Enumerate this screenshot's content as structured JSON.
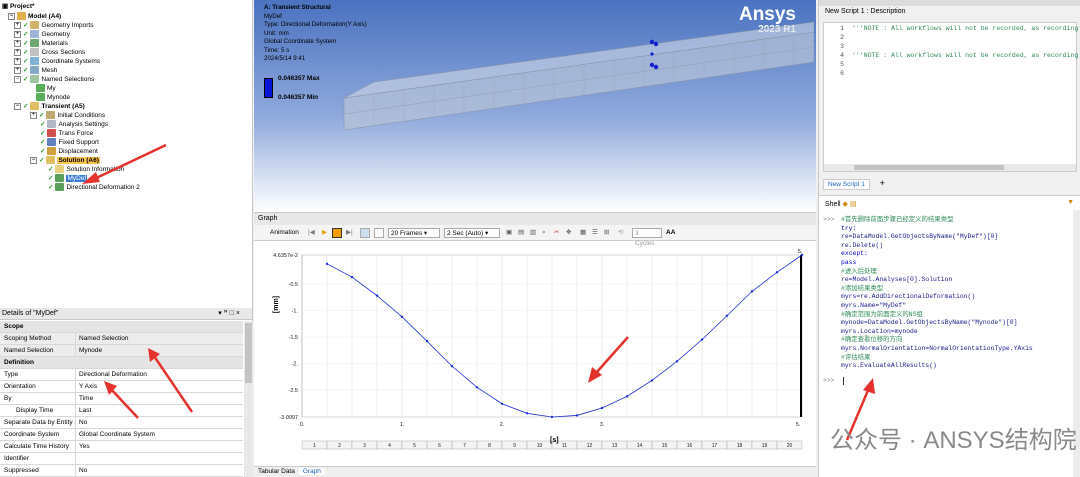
{
  "tree": {
    "project": "Project*",
    "model": "Model (A4)",
    "items": [
      "Geometry Imports",
      "Geometry",
      "Materials",
      "Cross Sections",
      "Coordinate Systems",
      "Mesh",
      "Named Selections",
      "My",
      "Mynode",
      "Transient (A5)",
      "Initial Conditions",
      "Analysis Settings",
      "Trans Force",
      "Fixed Support",
      "Displacement",
      "Solution (A6)",
      "Solution Information",
      "MyDef",
      "Directional Deformation 2"
    ]
  },
  "details": {
    "title": "Details of \"MyDef\"",
    "pin_glyph": "▾ ꟸ □ ×",
    "rows": [
      {
        "k": "Scope",
        "v": "",
        "section": true
      },
      {
        "k": "Scoping Method",
        "v": "Named Selection"
      },
      {
        "k": "Named Selection",
        "v": "Mynode"
      },
      {
        "k": "Definition",
        "v": "",
        "section": true
      },
      {
        "k": "Type",
        "v": "Directional Deformation"
      },
      {
        "k": "Orientation",
        "v": "Y Axis"
      },
      {
        "k": "By",
        "v": "Time"
      },
      {
        "k": "Display Time",
        "v": "Last"
      },
      {
        "k": "Separate Data by Entity",
        "v": "No"
      },
      {
        "k": "Coordinate System",
        "v": "Global Coordinate System"
      },
      {
        "k": "Calculate Time History",
        "v": "Yes"
      },
      {
        "k": "Identifier",
        "v": ""
      },
      {
        "k": "Suppressed",
        "v": "No"
      }
    ]
  },
  "viewport": {
    "header": "A: Transient Structural",
    "lines": [
      "MyDef",
      "Type: Directional Deformation(Y Axis)",
      "Unit: mm",
      "Global Coordinate System",
      "Time: 5 s",
      "2024/5/14 9:41"
    ],
    "max_label": "0.046357 Max",
    "min_label": "0.046357 Min",
    "logo": "Ansys",
    "version": "2023 R1"
  },
  "graph": {
    "title": "Graph",
    "toolbar": {
      "animation": "Animation",
      "frames": "20 Frames",
      "duration": "2 Sec (Auto)",
      "cycles": "3 Cycles",
      "aa": "AA"
    },
    "tabs": [
      "Tabular Data",
      "Graph"
    ]
  },
  "chart_data": {
    "type": "line",
    "ylabel": "[mm]",
    "xlabel": "[s]",
    "y_ticks": [
      "4.6357e-2",
      "-0.5",
      "-1.",
      "-1.5",
      "-2.",
      "-2.5",
      "-3.0097"
    ],
    "x_ticks": [
      "0.",
      "1.",
      "2.",
      "3.",
      "5."
    ],
    "frame_labels": [
      "1",
      "2",
      "3",
      "4",
      "5",
      "6",
      "7",
      "8",
      "9",
      "10",
      "11",
      "12",
      "13",
      "14",
      "15",
      "16",
      "17",
      "18",
      "19",
      "20"
    ],
    "xlim": [
      0,
      5
    ],
    "ylim": [
      -3.0097,
      0.046357
    ],
    "series": [
      {
        "x": [
          0.25,
          0.5,
          0.75,
          1.0,
          1.25,
          1.5,
          1.75,
          2.0,
          2.25,
          2.5,
          2.75,
          3.0,
          3.25,
          3.5,
          3.75,
          4.0,
          4.25,
          4.5,
          4.75,
          5.0
        ],
        "y": [
          -0.12,
          -0.37,
          -0.72,
          -1.12,
          -1.58,
          -2.05,
          -2.45,
          -2.76,
          -2.94,
          -3.0097,
          -2.98,
          -2.84,
          -2.62,
          -2.32,
          -1.96,
          -1.55,
          -1.1,
          -0.64,
          -0.28,
          0.046357
        ]
      }
    ],
    "line_color": "#1f2fd6",
    "grid": true
  },
  "editor": {
    "title": "New Script 1 : Description",
    "lines": [
      {
        "n": "1",
        "t": "'''NOTE : All workflows will not be recorded, as recording"
      },
      {
        "n": "2",
        "t": ""
      },
      {
        "n": "3",
        "t": ""
      },
      {
        "n": "4",
        "t": "'''NOTE : All workflows will not be recorded, as recording"
      },
      {
        "n": "5",
        "t": ""
      },
      {
        "n": "6",
        "t": ""
      }
    ],
    "tab": "New Script 1",
    "add": "+"
  },
  "shell": {
    "title": "Shell",
    "prompt": ">>>",
    "lines": [
      {
        "c": "cm",
        "t": "#首先删除前面步骤已经定义的结果类型"
      },
      {
        "c": "kw",
        "t": "try:"
      },
      {
        "c": "tx",
        "t": "        re=DataModel.GetObjectsByName(\"MyDef\")[0]"
      },
      {
        "c": "tx",
        "t": "        re.Delete()"
      },
      {
        "c": "kw",
        "t": "except:"
      },
      {
        "c": "kw",
        "t": "        pass"
      },
      {
        "c": "cm",
        "t": "#进入后处理"
      },
      {
        "c": "tx",
        "t": "re=Model.Analyses[0].Solution"
      },
      {
        "c": "cm",
        "t": "#添加结果类型"
      },
      {
        "c": "tx",
        "t": "myrs=re.AddDirectionalDeformation()"
      },
      {
        "c": "tx",
        "t": "myrs.Name=\"MyDef\""
      },
      {
        "c": "cm",
        "t": "#确定范围为前面定义的NS组"
      },
      {
        "c": "tx",
        "t": "mynode=DataModel.GetObjectsByName(\"Mynode\")[0]"
      },
      {
        "c": "tx",
        "t": "myrs.Location=mynode"
      },
      {
        "c": "cm",
        "t": "#确定查看位移的方向"
      },
      {
        "c": "tx",
        "t": "myrs.NormalOrientation=NormalOrientationType.YAxis"
      },
      {
        "c": "cm",
        "t": "#评估结果"
      },
      {
        "c": "tx",
        "t": "myrs.EvaluateAllResults()"
      }
    ]
  },
  "watermark": "公众号 · ANSYS结构院",
  "colors": {
    "arrow": "#e5322d",
    "selection": "#3a7bd5",
    "highlight": "#f7c34a"
  }
}
